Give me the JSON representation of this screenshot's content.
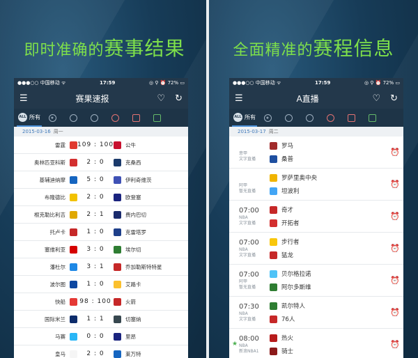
{
  "left": {
    "headline_small": "即时准确的",
    "headline_big": "赛事结果",
    "status": {
      "carrier": "●●●○○ 中国移动 ᯤ",
      "time": "17:59",
      "right": "◎ ⚲ ⏰ 72% ▭"
    },
    "nav_title": "赛果速报",
    "tab_all": "所有",
    "date": "2015-03-16",
    "weekday": "周一",
    "rows": [
      {
        "home": "雷霆",
        "score": "109 : 100",
        "away": "公牛",
        "hc": "#e03a2f",
        "ac": "#c8102e"
      },
      {
        "home": "奥林匹亚科斯",
        "score": "2 : 0",
        "away": "克桑西",
        "hc": "#d32f2f",
        "ac": "#1b3a6b"
      },
      {
        "home": "基辅迪纳摩",
        "score": "5 : 0",
        "away": "伊利奇维茨",
        "hc": "#1565c0",
        "ac": "#3f51b5"
      },
      {
        "home": "布隆德比",
        "score": "2 : 0",
        "away": "欧登塞",
        "hc": "#f2c200",
        "ac": "#1a237e"
      },
      {
        "home": "根克勒比利吉",
        "score": "2 : 1",
        "away": "费内巴切",
        "hc": "#e0a800",
        "ac": "#1a2b6d"
      },
      {
        "home": "托卢卡",
        "score": "1 : 0",
        "away": "克雷塔罗",
        "hc": "#c62828",
        "ac": "#1e3f8a"
      },
      {
        "home": "塞维利亚",
        "score": "3 : 0",
        "away": "埃尔切",
        "hc": "#d50000",
        "ac": "#2e7d32"
      },
      {
        "home": "潘杜尔",
        "score": "3 : 1",
        "away": "乔加勒斯特特星",
        "hc": "#1e88e5",
        "ac": "#c62828"
      },
      {
        "home": "波尔图",
        "score": "1 : 0",
        "away": "艾路卡",
        "hc": "#0d47a1",
        "ac": "#fbc02d"
      },
      {
        "home": "快船",
        "score": "98 : 100",
        "away": "火箭",
        "hc": "#e53935",
        "ac": "#c62828"
      },
      {
        "home": "国际米兰",
        "score": "1 : 1",
        "away": "切塞纳",
        "hc": "#0d2c6b",
        "ac": "#37474f"
      },
      {
        "home": "马赛",
        "score": "0 : 0",
        "away": "里昂",
        "hc": "#29b6f6",
        "ac": "#1a237e"
      },
      {
        "home": "皇马",
        "score": "2 : 0",
        "away": "莱万特",
        "hc": "#f5f5f5",
        "ac": "#1565c0"
      }
    ]
  },
  "right": {
    "headline_small": "全面精准的",
    "headline_big": "赛程信息",
    "status": {
      "carrier": "●●●○○ 中国移动 ᯤ",
      "time": "17:59",
      "right": "◎ ⚲ ⏰ 72% ▭"
    },
    "nav_title": "A直播",
    "tab_all": "所有",
    "date": "2015-03-17",
    "weekday": "周二",
    "matches": [
      {
        "time": "",
        "league": "意甲",
        "broadcast": "文字直播",
        "home": "罗马",
        "away": "桑普",
        "hc": "#a12b2b",
        "ac": "#1e4fa0",
        "star": false
      },
      {
        "time": "",
        "league": "阿甲",
        "broadcast": "暂无直播",
        "home": "罗萨里奥中央",
        "away": "坦波利",
        "hc": "#f0b400",
        "ac": "#42a5f5",
        "star": false
      },
      {
        "time": "07:00",
        "league": "NBA",
        "broadcast": "文字直播",
        "home": "奇才",
        "away": "开拓者",
        "hc": "#c62828",
        "ac": "#d32f2f",
        "star": false
      },
      {
        "time": "07:00",
        "league": "NBA",
        "broadcast": "文字直播",
        "home": "步行者",
        "away": "猛龙",
        "hc": "#f9c70c",
        "ac": "#c62828",
        "star": false
      },
      {
        "time": "07:00",
        "league": "阿甲",
        "broadcast": "暂无直播",
        "home": "贝尔格拉诺",
        "away": "阿尔多斯维",
        "hc": "#4fc3f7",
        "ac": "#2e7d32",
        "star": false
      },
      {
        "time": "07:30",
        "league": "NBA",
        "broadcast": "文字直播",
        "home": "凯尔特人",
        "away": "76人",
        "hc": "#2e7d32",
        "ac": "#c62828",
        "star": false
      },
      {
        "time": "08:00",
        "league": "NBA",
        "broadcast": "新浪NBA1",
        "home": "热火",
        "away": "骑士",
        "hc": "#b71c1c",
        "ac": "#8b1a1a",
        "star": true
      }
    ]
  }
}
